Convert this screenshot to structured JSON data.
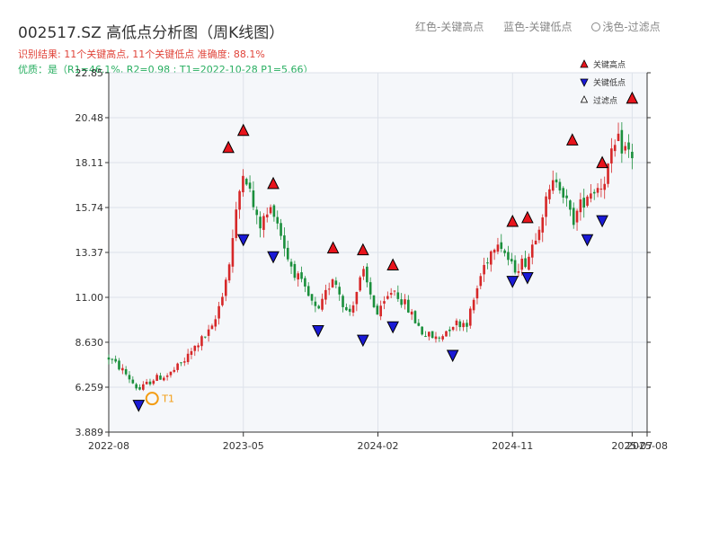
{
  "header": {
    "title": "002517.SZ 高低点分析图（周K线图）",
    "legend_red": "红色-关键高点",
    "legend_blue": "蓝色-关键低点",
    "legend_light": "浅色-过滤点",
    "result": "识别结果: 11个关键高点, 11个关键低点  准确度: 88.1%",
    "quality": "优质：是（R1=46.1%, R2=0.98 ; T1=2022-10-28 P1=5.66）"
  },
  "colors": {
    "up": "#d62728",
    "down": "#1a8f3c",
    "high_marker": "#e8141c",
    "low_marker": "#1a1ad6",
    "t1": "#f39c12",
    "plot_bg": "#f5f7fa",
    "grid": "#dde2ea"
  },
  "chart_data": {
    "type": "candlestick",
    "xlim": [
      "2022-08",
      "2025-08"
    ],
    "ylim": [
      3.889,
      22.85
    ],
    "y_ticks": [
      "22.85",
      "20.48",
      "18.11",
      "15.74",
      "13.37",
      "11.00",
      "8.630",
      "6.259",
      "3.889"
    ],
    "x_ticks": [
      "2022-08",
      "2023-05",
      "2024-02",
      "2024-11",
      "2025-07",
      "2025-08"
    ],
    "close_path": [
      [
        "2022-08",
        7.8
      ],
      [
        "2022-09",
        7.1
      ],
      [
        "2022-10",
        6.1
      ],
      [
        "2022-11",
        6.7
      ],
      [
        "2022-12",
        6.9
      ],
      [
        "2023-01",
        7.6
      ],
      [
        "2023-02",
        8.6
      ],
      [
        "2023-03",
        9.4
      ],
      [
        "2023-04",
        12.5
      ],
      [
        "2023-05",
        18.0
      ],
      [
        "2023-06",
        14.7
      ],
      [
        "2023-07",
        15.8
      ],
      [
        "2023-08",
        13.0
      ],
      [
        "2023-09",
        11.5
      ],
      [
        "2023-10",
        10.1
      ],
      [
        "2023-11",
        12.2
      ],
      [
        "2023-12",
        10.0
      ],
      [
        "2024-01",
        12.3
      ],
      [
        "2024-02",
        10.0
      ],
      [
        "2024-03",
        11.5
      ],
      [
        "2024-04",
        10.4
      ],
      [
        "2024-05",
        9.1
      ],
      [
        "2024-06",
        8.8
      ],
      [
        "2024-07",
        9.6
      ],
      [
        "2024-08",
        9.7
      ],
      [
        "2024-09",
        12.5
      ],
      [
        "2024-10",
        14.2
      ],
      [
        "2024-11",
        12.5
      ],
      [
        "2024-12",
        13.0
      ],
      [
        "2025-01",
        15.5
      ],
      [
        "2025-02",
        17.5
      ],
      [
        "2025-03",
        15.0
      ],
      [
        "2025-04",
        16.5
      ],
      [
        "2025-05",
        17.0
      ],
      [
        "2025-06",
        19.2
      ],
      [
        "2025-07",
        18.5
      ]
    ],
    "key_highs": [
      {
        "date": "2023-04",
        "value": 18.5
      },
      {
        "date": "2023-05",
        "value": 19.4
      },
      {
        "date": "2023-07",
        "value": 16.6
      },
      {
        "date": "2023-11",
        "value": 13.2
      },
      {
        "date": "2024-01",
        "value": 13.1
      },
      {
        "date": "2024-03",
        "value": 12.3
      },
      {
        "date": "2024-11",
        "value": 14.6
      },
      {
        "date": "2024-12",
        "value": 14.8
      },
      {
        "date": "2025-03",
        "value": 18.9
      },
      {
        "date": "2025-05",
        "value": 17.7
      },
      {
        "date": "2025-07",
        "value": 21.1
      }
    ],
    "key_lows": [
      {
        "date": "2022-10",
        "value": 5.66
      },
      {
        "date": "2023-05",
        "value": 14.4
      },
      {
        "date": "2023-07",
        "value": 13.5
      },
      {
        "date": "2023-10",
        "value": 9.6
      },
      {
        "date": "2024-01",
        "value": 9.1
      },
      {
        "date": "2024-03",
        "value": 9.8
      },
      {
        "date": "2024-07",
        "value": 8.3
      },
      {
        "date": "2024-11",
        "value": 12.2
      },
      {
        "date": "2024-12",
        "value": 12.4
      },
      {
        "date": "2025-04",
        "value": 14.4
      },
      {
        "date": "2025-05",
        "value": 15.4
      }
    ],
    "t1": {
      "date": "2022-10-28",
      "value": 5.66,
      "label": "T1"
    },
    "legend": [
      "关键高点",
      "关键低点",
      "过滤点"
    ],
    "legend_position": "top-right",
    "grid": true
  }
}
